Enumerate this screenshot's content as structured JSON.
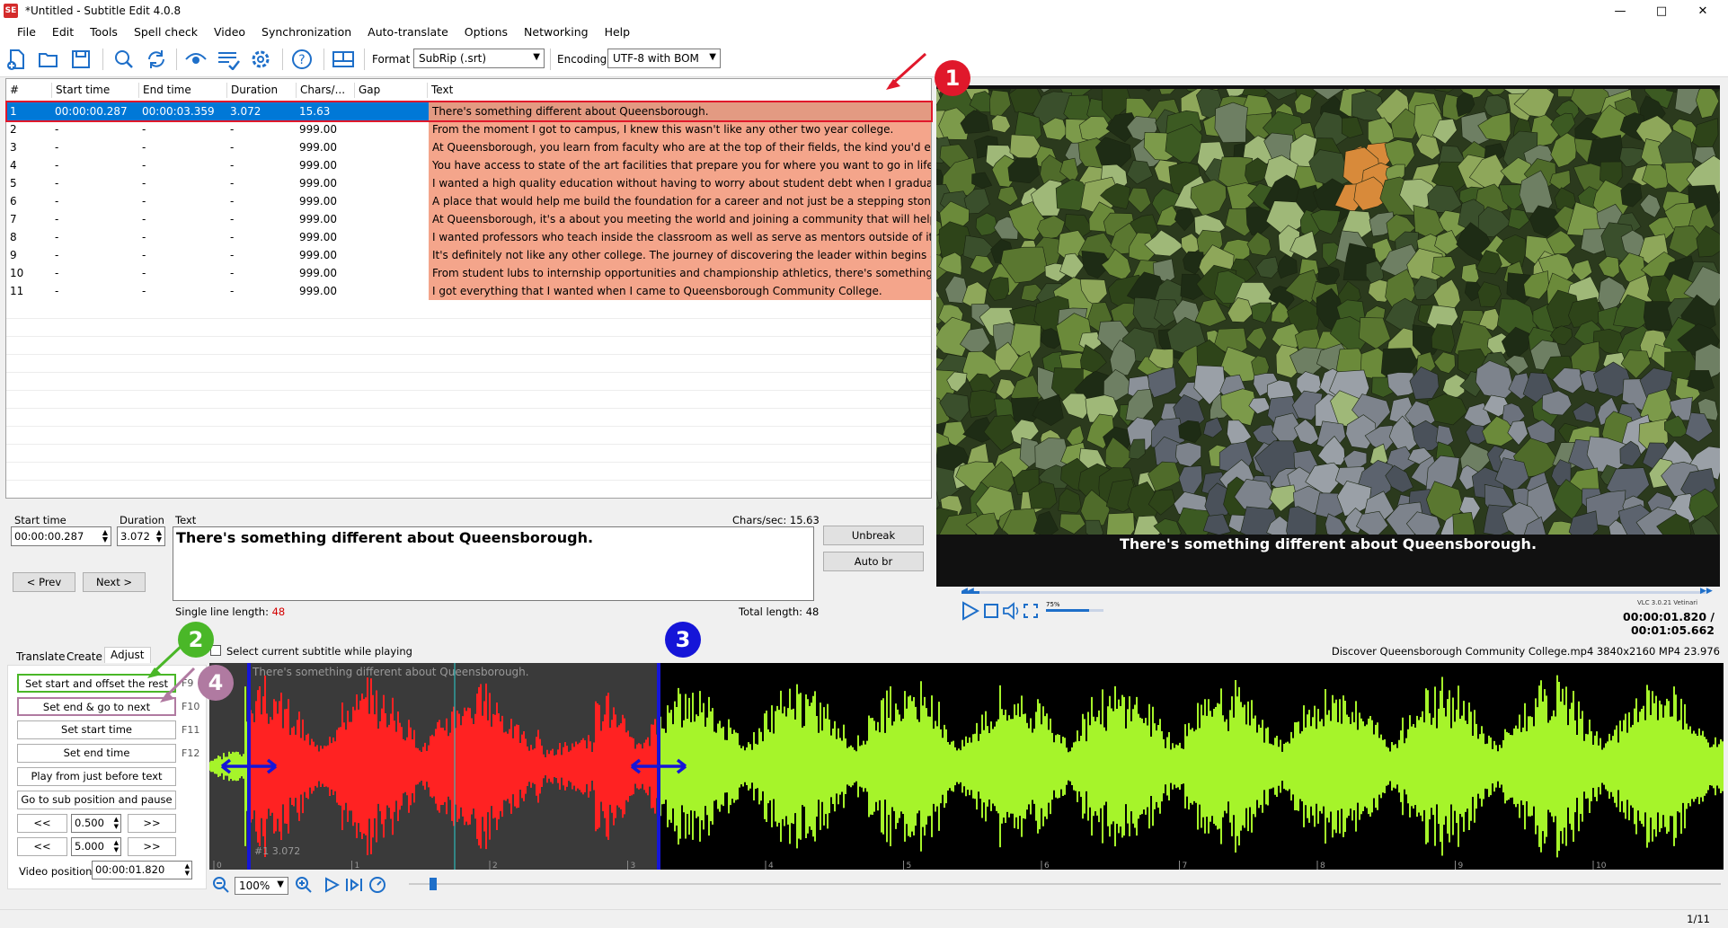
{
  "window": {
    "title": "*Untitled - Subtitle Edit 4.0.8",
    "icon": "SE"
  },
  "menu": [
    "File",
    "Edit",
    "Tools",
    "Spell check",
    "Video",
    "Synchronization",
    "Auto-translate",
    "Options",
    "Networking",
    "Help"
  ],
  "toolbar": {
    "format_label": "Format",
    "format_value": "SubRip (.srt)",
    "encoding_label": "Encoding",
    "encoding_value": "UTF-8 with BOM"
  },
  "grid": {
    "headers": [
      "#",
      "Start time",
      "End time",
      "Duration",
      "Chars/...",
      "Gap",
      "Text"
    ],
    "rows": [
      [
        "1",
        "00:00:00.287",
        "00:00:03.359",
        "3.072",
        "15.63",
        "",
        "There's something different about Queensborough."
      ],
      [
        "2",
        "-",
        "-",
        "-",
        "999.00",
        "",
        "From the moment I got to campus, I knew this wasn't like any other two year college."
      ],
      [
        "3",
        "-",
        "-",
        "-",
        "999.00",
        "",
        "At Queensborough, you learn from faculty who are at the top of their fields, the kind you'd ex..."
      ],
      [
        "4",
        "-",
        "-",
        "-",
        "999.00",
        "",
        "You have access to state of the art facilities that prepare you for where you want to go in life."
      ],
      [
        "5",
        "-",
        "-",
        "-",
        "999.00",
        "",
        "I wanted a high quality education without having to worry about student debt when I graduated."
      ],
      [
        "6",
        "-",
        "-",
        "-",
        "999.00",
        "",
        "A place that would help me build the foundation for a career and not just be a stepping stone..."
      ],
      [
        "7",
        "-",
        "-",
        "-",
        "999.00",
        "",
        "At Queensborough, it's a about you meeting the world and joining a community that will help ..."
      ],
      [
        "8",
        "-",
        "-",
        "-",
        "999.00",
        "",
        "I wanted professors who teach inside the classroom as well as serve as mentors outside of it."
      ],
      [
        "9",
        "-",
        "-",
        "-",
        "999.00",
        "",
        "It's definitely not like any other college. The journey of discovering the leader within begins at..."
      ],
      [
        "10",
        "-",
        "-",
        "-",
        "999.00",
        "",
        "From student lubs to internship opportunities and championship athletics, there's something h..."
      ],
      [
        "11",
        "-",
        "-",
        "-",
        "999.00",
        "",
        "I got everything that I wanted when I came to Queensborough Community College."
      ]
    ]
  },
  "editor": {
    "start_label": "Start time",
    "start_value": "00:00:00.287",
    "duration_label": "Duration",
    "duration_value": "3.072",
    "text_label": "Text",
    "chars_sec": "Chars/sec: 15.63",
    "text_value": "There's something different about Queensborough.",
    "prev": "< Prev",
    "next": "Next >",
    "unbreak": "Unbreak",
    "autobr": "Auto br",
    "single_line_label": "Single line length: ",
    "single_line_value": "48",
    "total_length": "Total length: 48"
  },
  "video": {
    "subtitle": "There's something different about Queensborough.",
    "time": "00:00:01.820 / 00:01:05.662",
    "vlc": "VLC 3.0.21 Vetinari",
    "volume": "75%"
  },
  "tabs": [
    "Translate",
    "Create",
    "Adjust"
  ],
  "adjust": {
    "buttons": [
      [
        "Set start and offset the rest",
        "F9"
      ],
      [
        "Set end & go to next",
        "F10"
      ],
      [
        "Set start time",
        "F11"
      ],
      [
        "Set end time",
        "F12"
      ],
      [
        "Play from just before text",
        ""
      ],
      [
        "Go to sub position and pause",
        ""
      ]
    ],
    "step1": "0.500",
    "step2": "5.000",
    "back": "<<",
    "fwd": ">>",
    "video_pos_label": "Video position:",
    "video_pos_value": "00:00:01.820"
  },
  "waveform": {
    "select_label": "Select current subtitle while playing",
    "file_info": "Discover Queensborough Community College.mp4 3840x2160 MP4 23.976",
    "sub_text": "There's something different about Queensborough.",
    "sub_info": "#1  3.072",
    "zoom": "100%",
    "ticks": [
      "0",
      "1",
      "2",
      "3",
      "4",
      "5",
      "6",
      "7",
      "8",
      "9",
      "10",
      "11"
    ]
  },
  "annotations": [
    "1",
    "2",
    "3",
    "4"
  ],
  "status": {
    "page": "1/11"
  },
  "colors": {
    "selected": "#0078d7",
    "row_bg": "#f4a58b",
    "wave_green": "#a6f42a",
    "wave_red": "#ff2222",
    "ann_red": "#e0182b",
    "ann_green": "#4ab728",
    "ann_blue": "#1515d8",
    "ann_purple": "#b07aa1"
  }
}
